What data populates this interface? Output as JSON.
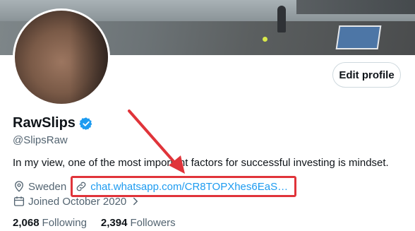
{
  "profile": {
    "name": "RawSlips",
    "handle": "@SlipsRaw",
    "bio": "In my view, one of the most important factors for successful investing is mindset.",
    "location": "Sweden",
    "website": "chat.whatsapp.com/CR8TOPXhes6EaS…",
    "joined": "Joined October 2020",
    "following_count": "2,068",
    "following_label": "Following",
    "followers_count": "2,394",
    "followers_label": "Followers"
  },
  "actions": {
    "edit_profile_label": "Edit profile"
  },
  "icons": {
    "verified": "verified-badge-icon",
    "location": "location-pin-icon",
    "link": "link-icon",
    "calendar": "calendar-icon",
    "chevron": "chevron-right-icon"
  },
  "colors": {
    "accent": "#1d9bf0",
    "annotation": "#e0343a",
    "text": "#0f1419",
    "muted": "#536471"
  }
}
